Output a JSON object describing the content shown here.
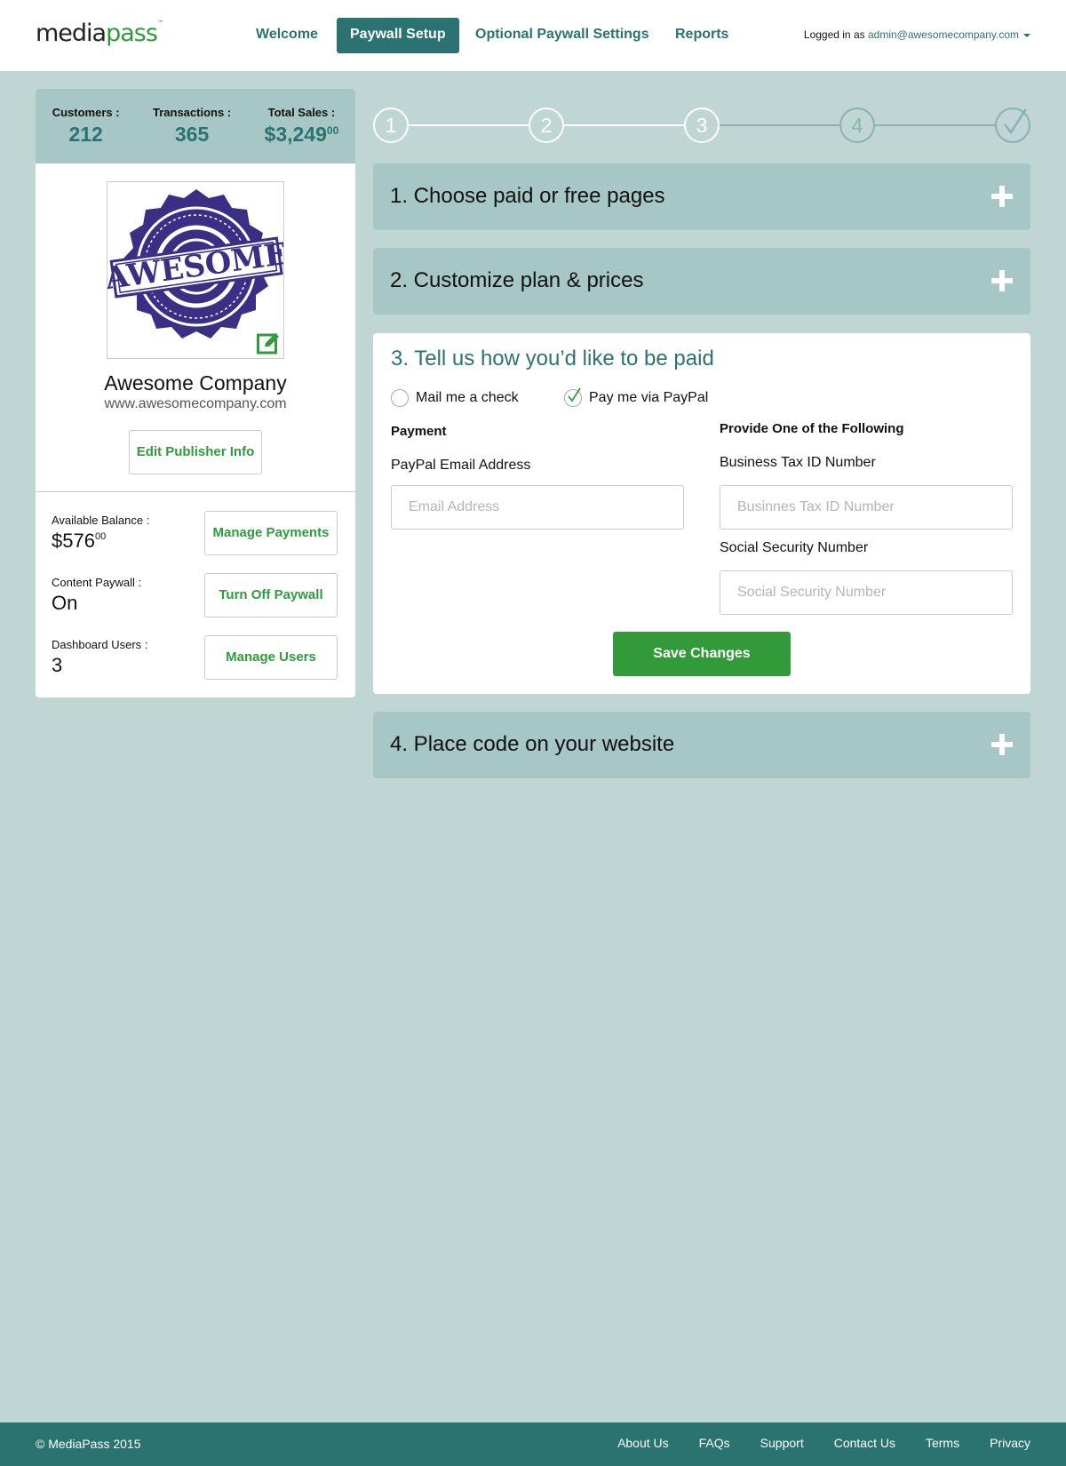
{
  "header": {
    "logo_part1": "media",
    "logo_part2": "pass",
    "logo_tm": "™",
    "nav": [
      "Welcome",
      "Paywall Setup",
      "Optional Paywall Settings",
      "Reports"
    ],
    "active_nav": "Paywall Setup",
    "logged_in_prefix": "Logged in as",
    "user_email": "admin@awesomecompany.com"
  },
  "sidebar": {
    "stats": {
      "customers_label": "Customers :",
      "customers_value": "212",
      "transactions_label": "Transactions :",
      "transactions_value": "365",
      "sales_label": "Total Sales :",
      "sales_value": "$3,249",
      "sales_cents": "00"
    },
    "company_logo_text": "AWESOME",
    "company_name": "Awesome Company",
    "company_url": "www.awesomecompany.com",
    "edit_publisher_label": "Edit Publisher Info",
    "balance_label": "Available Balance :",
    "balance_value": "$576",
    "balance_cents": "00",
    "manage_payments_label": "Manage Payments",
    "paywall_label": "Content Paywall :",
    "paywall_value": "On",
    "turn_off_paywall_label": "Turn Off Paywall",
    "users_label": "Dashboard Users :",
    "users_value": "3",
    "manage_users_label": "Manage Users"
  },
  "steps": {
    "labels": [
      "1",
      "2",
      "3",
      "4"
    ],
    "current": 3
  },
  "accordions": {
    "step1": "1. Choose paid or free pages",
    "step2": "2. Customize plan & prices",
    "step4": "4. Place code on your website"
  },
  "payment_panel": {
    "title": "3. Tell us how you’d like to be paid",
    "option_check": "Mail me a check",
    "option_paypal": "Pay me via PayPal",
    "selected_option": "Pay me via PayPal",
    "payment_heading": "Payment",
    "paypal_email_label": "PayPal Email Address",
    "paypal_email_placeholder": "Email Address",
    "provide_heading": "Provide One of the Following",
    "tax_id_label": "Business Tax ID Number",
    "tax_id_placeholder": "Businnes Tax ID Number",
    "ssn_label": "Social Security Number",
    "ssn_placeholder": "Social Security Number",
    "save_label": "Save Changes"
  },
  "footer": {
    "copyright": "© MediaPass 2015",
    "links": [
      "About Us",
      "FAQs",
      "Support",
      "Contact Us",
      "Terms",
      "Privacy"
    ]
  },
  "colors": {
    "brand_teal": "#2a7370",
    "brand_green": "#339a3a",
    "page_background": "#bfd6d4",
    "accordion_background": "#a6c7c5",
    "stamp_purple": "#3b2f85"
  }
}
